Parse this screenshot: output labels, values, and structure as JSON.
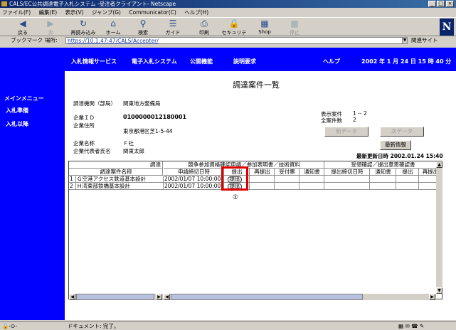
{
  "window": {
    "title": "CALS/EC公共調達電子入札システム -受注者クライアント- Netscape",
    "min": "_",
    "max": "□",
    "close": "×"
  },
  "menu": [
    "ファイル(F)",
    "編集(E)",
    "表示(V)",
    "ジャンプ(G)",
    "Communicator(C)",
    "ヘルプ(H)"
  ],
  "toolbar": [
    {
      "label": "戻る",
      "icon": "◀"
    },
    {
      "label": "次",
      "icon": "▶"
    },
    {
      "label": "再読み込み",
      "icon": "↻"
    },
    {
      "label": "ホーム",
      "icon": "⌂"
    },
    {
      "label": "検索",
      "icon": "⚲"
    },
    {
      "label": "ガイド",
      "icon": "☰"
    },
    {
      "label": "印刷",
      "icon": "⎙"
    },
    {
      "label": "セキュリティ",
      "icon": "🔒"
    },
    {
      "label": "Shop",
      "icon": "▦"
    },
    {
      "label": "停止",
      "icon": "▩"
    }
  ],
  "location": {
    "bookmarks": "ブックマーク",
    "label": "場所:",
    "url": "https://10.1.47:47/CALS/Accepter/",
    "related": "関連サイト"
  },
  "leftnav": [
    "メインメニュー",
    "入札準備",
    "入札以降"
  ],
  "topnav": {
    "items": [
      "入札情報サービス",
      "電子入札システム",
      "公開機能",
      "説明要求"
    ],
    "help": "ヘルプ",
    "datetime": "2002 年  1 月 24 日  15 時 40 分"
  },
  "page": {
    "title": "調達案件一覧"
  },
  "info": {
    "org_label": "調達機関（部局）",
    "org_value": "関東地方整備局",
    "id_label": "企業ＩＤ",
    "id_value": "0100000012180001",
    "addr_label": "企業住所",
    "addr_value": "東京都港区芝1-5-44",
    "name_label": "企業名称",
    "name_value": "Ｆ社",
    "rep_label": "企業代表者氏名",
    "rep_value": "関東太郎"
  },
  "summary": {
    "display_label": "表示案件",
    "display_value": "1 -- 2",
    "total_label": "全案件数",
    "total_value": "2"
  },
  "buttons": {
    "prev": "前データ",
    "next": "次データ",
    "latest": "最新情報"
  },
  "updated": "最新更新日時 2002.01.24 15:40",
  "grid": {
    "left_header": "調達",
    "left_sub": "調達案件名称",
    "section1": "競争参加資格確認申請／参加表明書／技術資料",
    "section2": "受領確認／提出意思確認書",
    "cols1": [
      "申請締切日時",
      "提出",
      "再提出",
      "受付票",
      "通知書"
    ],
    "cols2": [
      "提出締切日時",
      "通知書",
      "提出",
      "再提出"
    ],
    "rows": [
      {
        "no": "1",
        "name": "Ｇ空港アクセス鉄道基本設計",
        "deadline": "2002/01/07 10:00:00",
        "submit": "提出"
      },
      {
        "no": "2",
        "name": "Ｈ湾東部鉄橋基本設計",
        "deadline": "2002/01/07 10:00:00",
        "submit": "提出"
      }
    ],
    "marker": "①"
  },
  "status": {
    "text": "ドキュメント: 完了。"
  }
}
